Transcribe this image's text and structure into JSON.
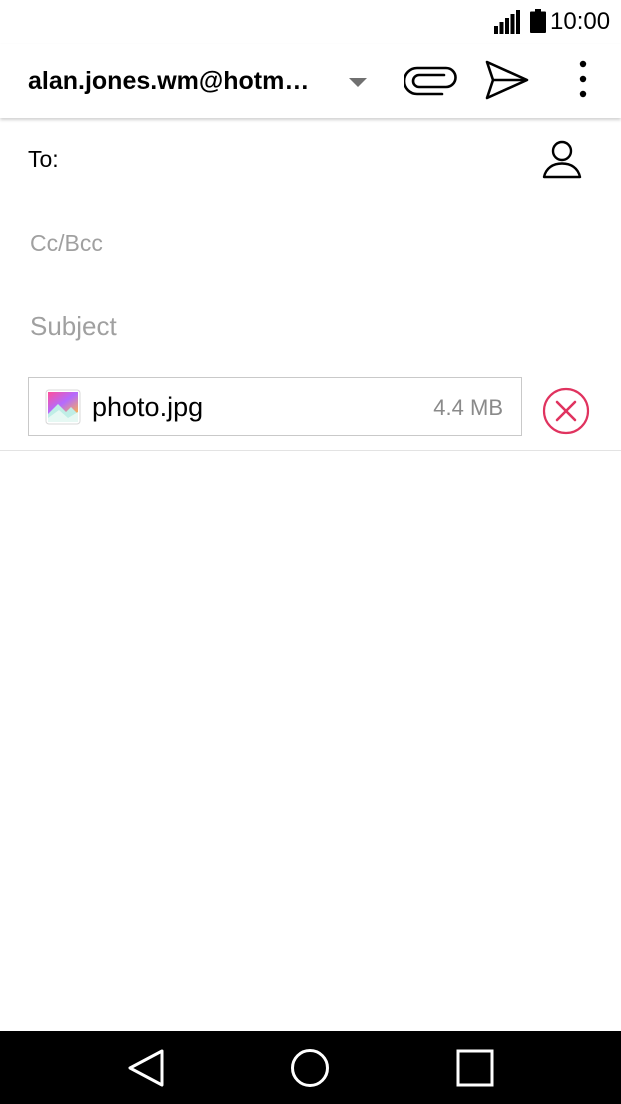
{
  "status_bar": {
    "time": "10:00",
    "signal_icon": "signal-icon",
    "battery_icon": "battery-icon"
  },
  "app_bar": {
    "from_account": "alan.jones.wm@hotm…",
    "dropdown_icon": "caret-down-icon",
    "attach_icon": "paperclip-icon",
    "send_icon": "send-icon",
    "more_icon": "more-vert-icon"
  },
  "compose": {
    "to_label": "To:",
    "to_value": "",
    "contact_icon": "contact-person-icon",
    "cc_placeholder": "Cc/Bcc",
    "subject_placeholder": "Subject",
    "body_value": ""
  },
  "attachment": {
    "name": "photo.jpg",
    "size": "4.4 MB",
    "thumb_icon": "image-file-icon",
    "remove_icon": "remove-circle-icon"
  },
  "nav_bar": {
    "back_icon": "back-icon",
    "home_icon": "home-icon",
    "recents_icon": "recents-icon"
  },
  "colors": {
    "remove_accent": "#e0335f",
    "divider": "#e3e3e3",
    "placeholder": "#a0a0a0",
    "nav_background": "#000000"
  }
}
